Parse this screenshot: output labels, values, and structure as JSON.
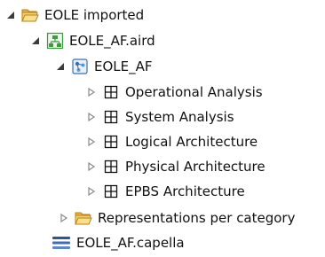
{
  "tree": {
    "root": {
      "label": "EOLE imported",
      "icon": "folder-open-icon",
      "expanded": true
    },
    "aird": {
      "label": "EOLE_AF.aird",
      "icon": "aird-diagram-file-icon",
      "expanded": true
    },
    "project": {
      "label": "EOLE_AF",
      "icon": "capella-project-icon",
      "expanded": true
    },
    "children": [
      {
        "label": "Operational Analysis",
        "icon": "package-icon",
        "expanded": false
      },
      {
        "label": "System Analysis",
        "icon": "package-icon",
        "expanded": false
      },
      {
        "label": "Logical Architecture",
        "icon": "package-icon",
        "expanded": false
      },
      {
        "label": "Physical Architecture",
        "icon": "package-icon",
        "expanded": false
      },
      {
        "label": "EPBS Architecture",
        "icon": "package-icon",
        "expanded": false
      }
    ],
    "representations": {
      "label": "Representations per category",
      "icon": "folder-open-icon",
      "expanded": false
    },
    "capella": {
      "label": "EOLE_AF.capella",
      "icon": "capella-model-file-icon"
    }
  },
  "colors": {
    "folder": "#e8b440",
    "folder_dark": "#b98218",
    "aird_green": "#3e9a3e",
    "project_blue": "#3b6fb0",
    "twisty_expanded": "#3b3b3b",
    "twisty_collapsed": "#8a8a8a",
    "capella_blue": "#2f5597"
  }
}
